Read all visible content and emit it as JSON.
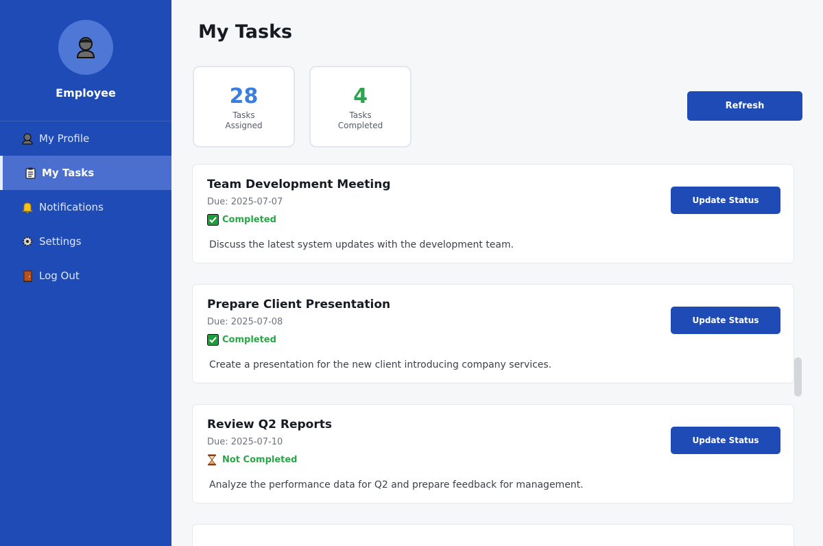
{
  "sidebar": {
    "role": "Employee",
    "items": [
      {
        "label": "My Profile",
        "icon": "user-icon"
      },
      {
        "label": "My Tasks",
        "icon": "clipboard-icon"
      },
      {
        "label": "Notifications",
        "icon": "bell-icon"
      },
      {
        "label": "Settings",
        "icon": "gear-icon"
      },
      {
        "label": "Log Out",
        "icon": "door-icon"
      }
    ],
    "active_item": "My Tasks"
  },
  "page": {
    "title": "My Tasks"
  },
  "stats": {
    "assigned": {
      "value": "28",
      "label_line1": "Tasks",
      "label_line2": "Assigned",
      "color": "#3b7ee0"
    },
    "completed": {
      "value": "4",
      "label_line1": "Tasks",
      "label_line2": "Completed",
      "color": "#2ea44f"
    }
  },
  "refresh_label": "Refresh",
  "tasks": [
    {
      "title": "Team Development Meeting",
      "due": "Due: 2025-07-07",
      "status": "Completed",
      "status_icon": "check-box-icon",
      "description": "Discuss the latest system updates with the development team.",
      "button": "Update Status"
    },
    {
      "title": "Prepare Client Presentation",
      "due": "Due: 2025-07-08",
      "status": "Completed",
      "status_icon": "check-box-icon",
      "description": "Create a presentation for the new client introducing company services.",
      "button": "Update Status"
    },
    {
      "title": "Review Q2 Reports",
      "due": "Due: 2025-07-10",
      "status": "Not Completed",
      "status_icon": "hourglass-icon",
      "description": "Analyze the performance data for Q2 and prepare feedback for management.",
      "button": "Update Status"
    }
  ],
  "colors": {
    "sidebar": "#1e4bb6",
    "accent": "#1e4bb6",
    "success": "#28a745"
  }
}
